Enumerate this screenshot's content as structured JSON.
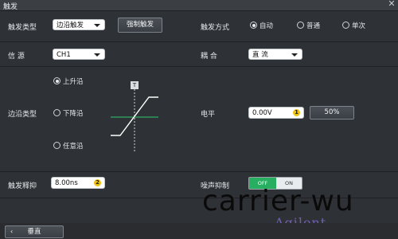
{
  "window": {
    "title": "触发",
    "close_icon": "close-icon"
  },
  "row1": {
    "trigger_type_label": "触发类型",
    "trigger_type_value": "边沿触发",
    "force_trigger_label": "强制触发",
    "trigger_mode_label": "触发方式",
    "modes": [
      {
        "label": "自动",
        "selected": true
      },
      {
        "label": "普通",
        "selected": false
      },
      {
        "label": "单次",
        "selected": false
      }
    ]
  },
  "row2": {
    "source_label": "信 源",
    "source_value": "CH1",
    "coupling_label": "耦 合",
    "coupling_value": "直 流"
  },
  "row3": {
    "edge_type_label": "边沿类型",
    "edges": [
      {
        "label": "上升沿",
        "selected": true
      },
      {
        "label": "下降沿",
        "selected": false
      },
      {
        "label": "任意沿",
        "selected": false
      }
    ],
    "diagram_marker": "T",
    "level_label": "电平",
    "level_value": "0.00V",
    "level_knob": "1",
    "fifty_label": "50%"
  },
  "row4": {
    "holdoff_label": "触发释抑",
    "holdoff_value": "8.00ns",
    "holdoff_knob": "2",
    "noise_label": "噪声抑制",
    "toggle_off": "OFF",
    "toggle_on": "ON"
  },
  "bottom": {
    "back_label": "垂直",
    "back_icon": "chevron-left-icon"
  },
  "watermark": {
    "text": "carrier-wu",
    "brand": "Agilent"
  },
  "colors": {
    "toggle_active": "#27ae60",
    "knob": "#f1c40f",
    "trace": "#ffffff",
    "crosshair": "#2ecc71"
  }
}
